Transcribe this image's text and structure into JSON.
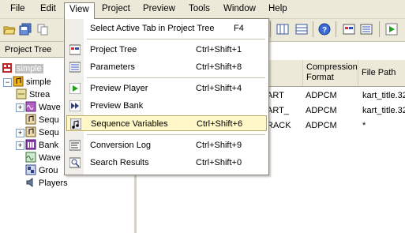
{
  "menubar": {
    "items": [
      {
        "label": "File"
      },
      {
        "label": "Edit"
      },
      {
        "label": "View"
      },
      {
        "label": "Project"
      },
      {
        "label": "Preview"
      },
      {
        "label": "Tools"
      },
      {
        "label": "Window"
      },
      {
        "label": "Help"
      }
    ],
    "active": "View"
  },
  "view_menu": {
    "items": [
      {
        "label": "Select Active Tab in Project Tree",
        "shortcut": "F4"
      },
      {
        "label": "Project Tree",
        "shortcut": "Ctrl+Shift+1"
      },
      {
        "label": "Parameters",
        "shortcut": "Ctrl+Shift+8"
      },
      {
        "label": "Preview Player",
        "shortcut": "Ctrl+Shift+4"
      },
      {
        "label": "Preview Bank",
        "shortcut": ""
      },
      {
        "label": "Sequence Variables",
        "shortcut": "Ctrl+Shift+6"
      },
      {
        "label": "Conversion Log",
        "shortcut": "Ctrl+Shift+9"
      },
      {
        "label": "Search Results",
        "shortcut": "Ctrl+Shift+0"
      }
    ],
    "highlighted": "Sequence Variables"
  },
  "project_tree": {
    "title": "Project Tree",
    "tab_label": "simple",
    "root": "simple",
    "children": [
      "Strea",
      "Wave",
      "Sequ",
      "Sequ",
      "Bank",
      "Wave",
      "Grou",
      "Players"
    ]
  },
  "table": {
    "headers": [
      "Compression Format",
      "File Path"
    ],
    "rows": [
      {
        "name": "ART",
        "format": "ADPCM",
        "path": "kart_title.32"
      },
      {
        "name": "ART_",
        "format": "ADPCM",
        "path": "kart_title.32"
      },
      {
        "name": "RACK",
        "format": "ADPCM",
        "path": "*"
      }
    ]
  },
  "colors": {
    "background": "#ece9d8",
    "menu_highlight": "#fff7c8",
    "menu_highlight_border": "#b8a96a"
  }
}
